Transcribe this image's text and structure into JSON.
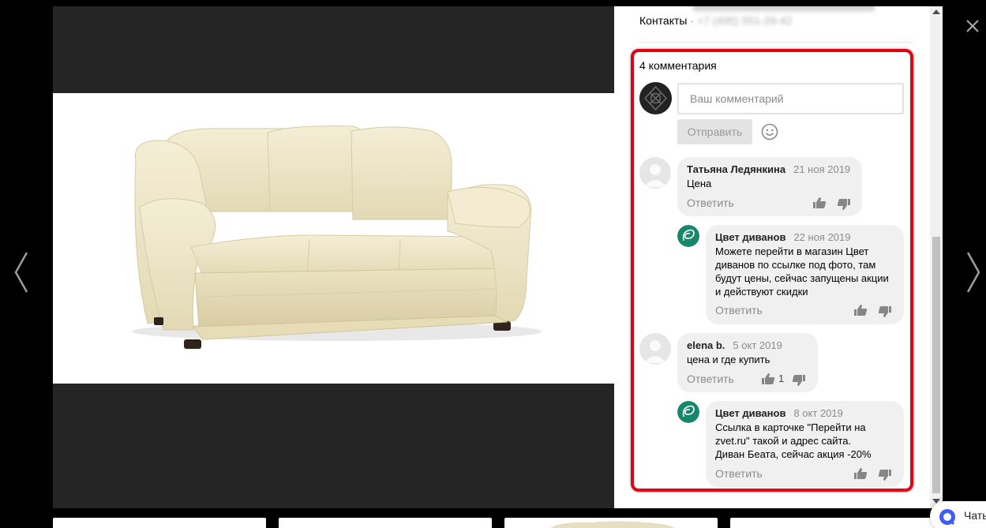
{
  "post": {
    "contacts_label": "Контакты",
    "contacts_separator": "·",
    "contacts_phone": "+7 (495) 551-29-42"
  },
  "comments_section": {
    "count_label": "4 комментария",
    "input_placeholder": "Ваш комментарий",
    "send_label": "Отправить"
  },
  "comments": [
    {
      "author": "Татьяна Ледянкина",
      "date": "21 ноя 2019",
      "text": "Цена",
      "reply_label": "Ответить",
      "likes": ""
    },
    {
      "author": "Цвет диванов",
      "date": "22 ноя 2019",
      "text_lines": [
        "Можете перейти в магазин Цвет",
        "диванов по ссылке под фото, там",
        "будут цены, сейчас запущены акции",
        "и действуют скидки"
      ],
      "reply_label": "Ответить",
      "likes": ""
    },
    {
      "author": "elena b.",
      "date": "5 окт 2019",
      "text": "цена и где купить",
      "reply_label": "Ответить",
      "likes": "1"
    },
    {
      "author": "Цвет диванов",
      "date": "8 окт 2019",
      "text_lines": [
        "Ссылка в карточке \"Перейти на",
        "zvet.ru\" такой и адрес сайта.",
        "Диван Беата, сейчас акция -20%"
      ],
      "reply_label": "Ответить",
      "likes": ""
    }
  ],
  "chat": {
    "label": "Чать"
  },
  "colors": {
    "highlight_border": "#e20015",
    "brand_avatar": "#17866a",
    "bubble_bg": "#f0f0f0",
    "sofa": "#efe7c8"
  },
  "icons": [
    "chevron-left-icon",
    "chevron-right-icon",
    "close-icon",
    "emoji-icon",
    "thumb-up-icon",
    "thumb-down-icon",
    "chat-icon"
  ]
}
